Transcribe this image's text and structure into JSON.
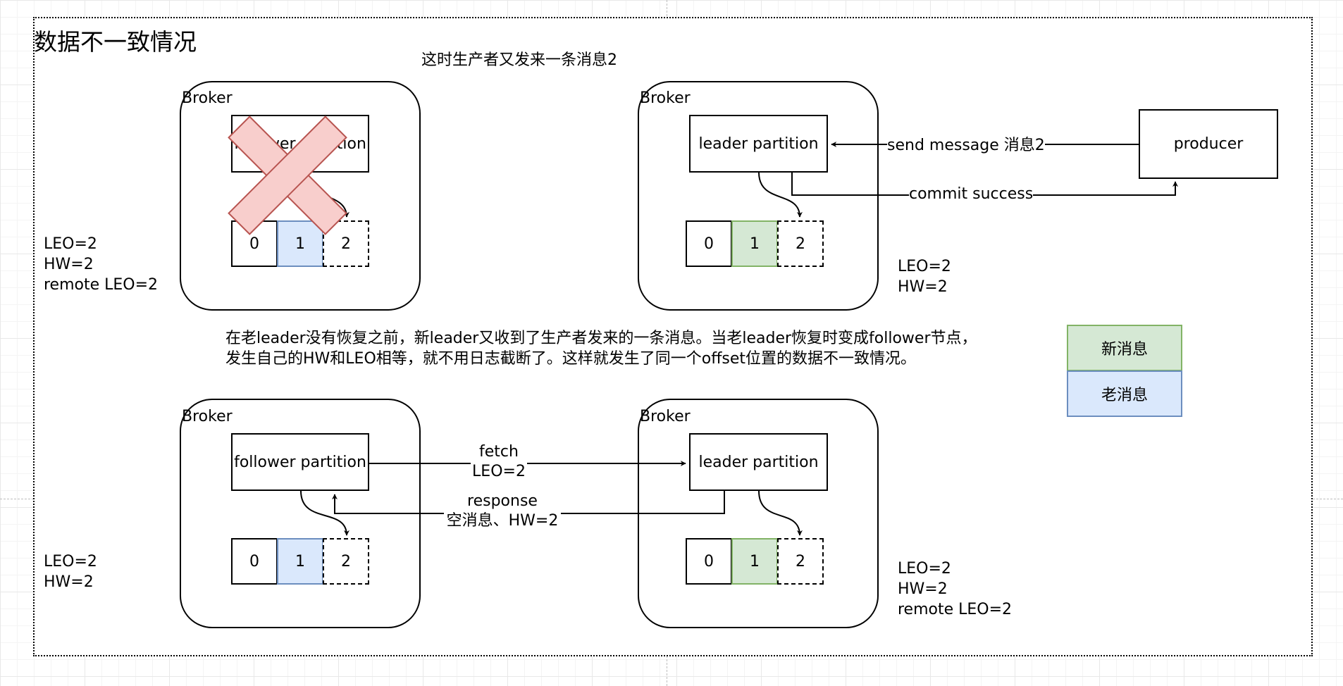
{
  "title": "数据不一致情况",
  "top_note": "这时生产者又发来一条消息2",
  "description": [
    "在老leader没有恢复之前，新leader又收到了生产者发来的一条消息。当老leader恢复时变成follower节点，",
    "发生自己的HW和LEO相等，就不用日志截断了。这样就发生了同一个offset位置的数据不一致情况。"
  ],
  "broker_label": "Broker",
  "top_left": {
    "partition": "follower partition",
    "cells": [
      "0",
      "1",
      "2"
    ],
    "stats": [
      "LEO=2",
      "HW=2",
      "remote LEO=2"
    ],
    "crossed_out": true
  },
  "top_right": {
    "partition": "leader partition",
    "cells": [
      "0",
      "1",
      "2"
    ],
    "stats": [
      "LEO=2",
      "HW=2"
    ]
  },
  "producer": {
    "label": "producer",
    "send_label": "send message 消息2",
    "commit_label": "commit success"
  },
  "bottom_left": {
    "partition": "follower partition",
    "cells": [
      "0",
      "1",
      "2"
    ],
    "stats": [
      "LEO=2",
      "HW=2"
    ]
  },
  "bottom_right": {
    "partition": "leader partition",
    "cells": [
      "0",
      "1",
      "2"
    ],
    "stats": [
      "LEO=2",
      "HW=2",
      "remote LEO=2"
    ]
  },
  "fetch_label": [
    "fetch",
    "LEO=2"
  ],
  "response_label": [
    "response",
    "空消息、HW=2"
  ],
  "legend": [
    {
      "label": "新消息",
      "color": "#d5e8d4"
    },
    {
      "label": "老消息",
      "color": "#dae8fc"
    }
  ],
  "colors": {
    "new_fill": "#d5e8d4",
    "new_stroke": "#82b366",
    "old_fill": "#dae8fc",
    "old_stroke": "#6c8ebf",
    "cross_fill": "#f8cecc",
    "cross_stroke": "#b85450"
  }
}
